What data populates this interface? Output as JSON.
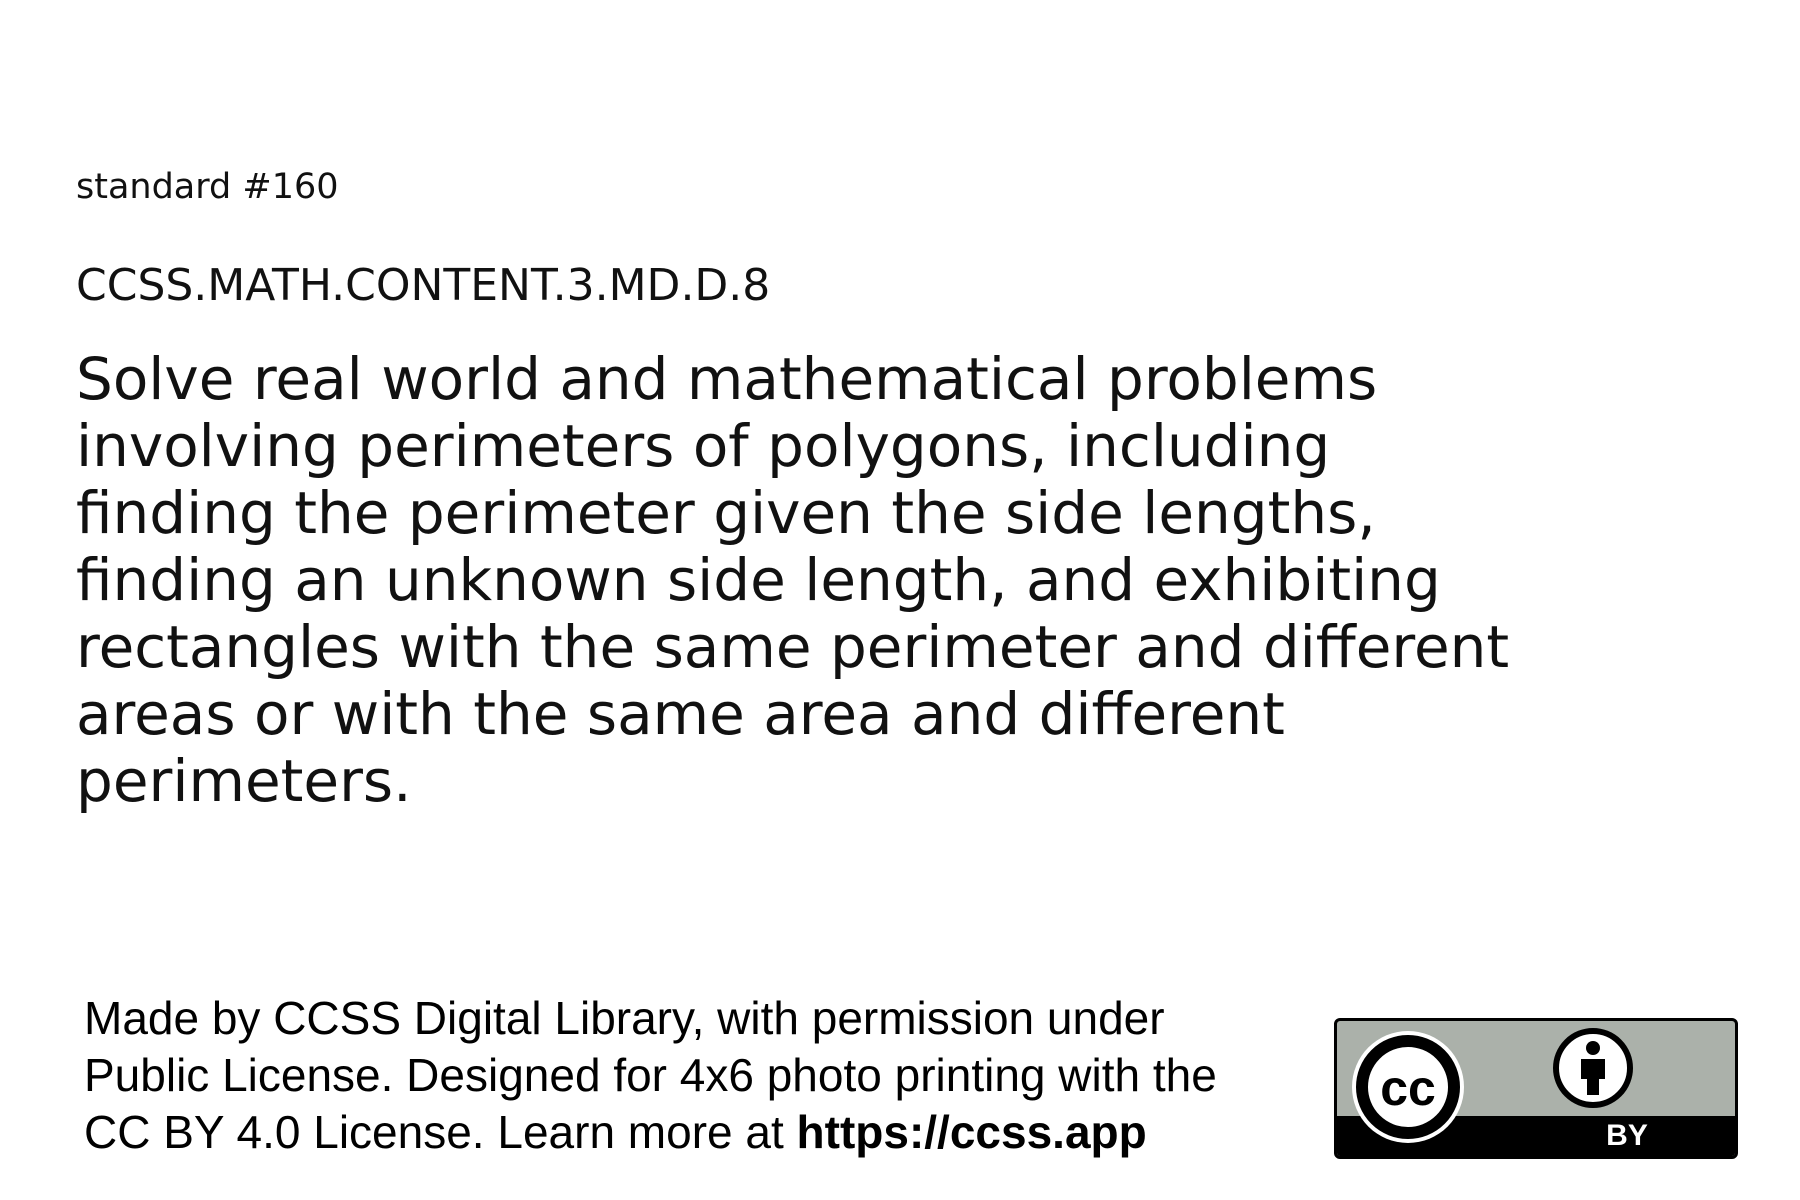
{
  "standard": {
    "number_label": "standard #160",
    "code": "CCSS.MATH.CONTENT.3.MD.D.8",
    "description_lines": [
      "Solve real world and mathematical problems",
      "involving perimeters of polygons, including",
      "finding the perimeter given the side lengths,",
      "finding an unknown side length, and exhibiting",
      "rectangles with the same perimeter and different",
      "areas or with the same area and different",
      "perimeters."
    ]
  },
  "footer": {
    "line1": "Made by CCSS Digital Library, with permission under",
    "line2": "Public License. Designed for 4x6 photo printing with the",
    "line3_prefix": "CC BY 4.0 License. Learn more at ",
    "link": "https://ccss.app"
  },
  "license_badge": {
    "cc_text": "cc",
    "by_text": "BY",
    "icons": [
      "cc-logo-icon",
      "attribution-person-icon"
    ],
    "colors": {
      "badge_gray": "#abb1aa",
      "badge_black": "#000000",
      "badge_white": "#ffffff"
    }
  }
}
